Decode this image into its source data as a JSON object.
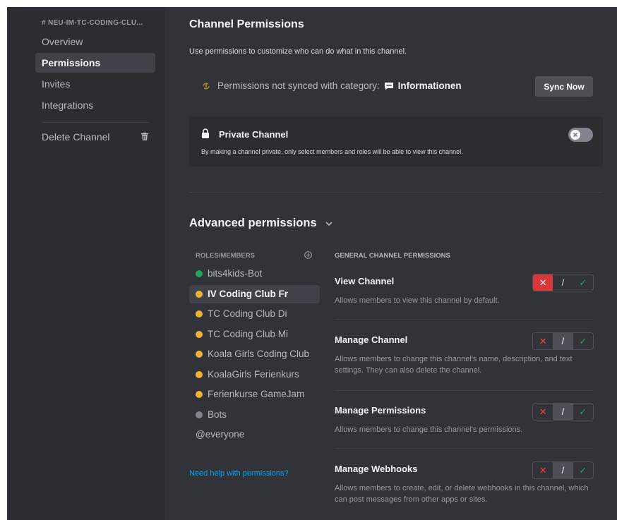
{
  "sidebar": {
    "header": "# NEU-IM-TC-CODING-CLU...",
    "items": [
      {
        "label": "Overview"
      },
      {
        "label": "Permissions"
      },
      {
        "label": "Invites"
      },
      {
        "label": "Integrations"
      }
    ],
    "delete_label": "Delete Channel",
    "delete_icon": "trash-icon"
  },
  "main": {
    "title": "Channel Permissions",
    "subtitle": "Use permissions to customize who can do what in this channel.",
    "sync": {
      "text": "Permissions not synced with category:",
      "category": "Informationen",
      "button": "Sync Now"
    },
    "private": {
      "title": "Private Channel",
      "description": "By making a channel private, only select members and roles will be able to view this channel.",
      "enabled": false
    },
    "advanced": {
      "title": "Advanced permissions"
    },
    "roles": {
      "header": "ROLES/MEMBERS",
      "items": [
        {
          "label": "bits4kids-Bot",
          "color": "#23a55a"
        },
        {
          "label": "IV Coding Club Fr",
          "color": "#f0b232"
        },
        {
          "label": "TC Coding Club Di",
          "color": "#f0b232"
        },
        {
          "label": "TC Coding Club Mi",
          "color": "#f0b232"
        },
        {
          "label": "Koala Girls Coding Club",
          "color": "#f0b232"
        },
        {
          "label": "KoalaGirls Ferienkurs",
          "color": "#f0b232"
        },
        {
          "label": "Ferienkurse GameJam",
          "color": "#f0b232"
        },
        {
          "label": "Bots",
          "color": "#80848e"
        },
        {
          "label": "@everyone"
        }
      ],
      "help": "Need help with permissions?"
    },
    "permissions": {
      "header": "GENERAL CHANNEL PERMISSIONS",
      "items": [
        {
          "name": "View Channel",
          "description": "Allows members to view this channel by default.",
          "state": "deny"
        },
        {
          "name": "Manage Channel",
          "description": "Allows members to change this channel's name, description, and text settings. They can also delete the channel.",
          "state": "neutral"
        },
        {
          "name": "Manage Permissions",
          "description": "Allows members to change this channel's permissions.",
          "state": "neutral"
        },
        {
          "name": "Manage Webhooks",
          "description": "Allows members to create, edit, or delete webhooks in this channel, which can post messages from other apps or sites.",
          "state": "neutral"
        }
      ],
      "symbols": {
        "deny": "✕",
        "neutral": "/",
        "allow": "✓"
      }
    }
  },
  "colors": {
    "accent_link": "#00a8fc",
    "deny": "#da373c",
    "allow": "#23a55a"
  }
}
